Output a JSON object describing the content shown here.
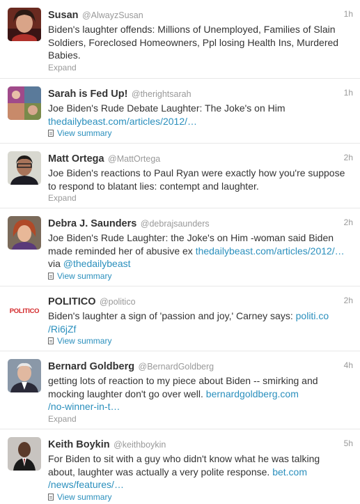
{
  "tweets": [
    {
      "name": "Susan",
      "handle": "@AlwayzSusan",
      "time": "1h",
      "lines": [
        "Biden's laughter offends: Millions of Unemployed, Families of Slain",
        "Soldiers, Foreclosed Homeowners, Ppl losing Health Ins, Murdered",
        "Babies."
      ],
      "action": "Expand"
    },
    {
      "name": "Sarah is Fed Up!",
      "handle": "@therightsarah",
      "time": "1h",
      "lines": [
        "Joe Biden's Rude Debate Laughter: The Joke's on Him"
      ],
      "link": "thedailybeast.com/articles/2012/…",
      "action": "View summary"
    },
    {
      "name": "Matt Ortega",
      "handle": "@MattOrtega",
      "time": "2h",
      "lines": [
        "Joe Biden's reactions to Paul Ryan were exactly how you're suppose",
        "to respond to blatant lies: contempt and laughter."
      ],
      "action": "Expand"
    },
    {
      "name": "Debra J. Saunders",
      "handle": "@debrajsaunders",
      "time": "2h",
      "line1": "Joe Biden's Rude Laughter: the Joke's on Him -woman said Biden",
      "line2_text": "made reminded her of abusive ex ",
      "line2_link": "thedailybeast.com/articles/2012/…",
      "line3_text": "via ",
      "line3_link": "@thedailybeast",
      "action": "View summary"
    },
    {
      "name": "POLITICO",
      "handle": "@politico",
      "time": "2h",
      "avatar_text": "POLITICO",
      "line1_text": "Biden's laughter a sign of 'passion and joy,' Carney says: ",
      "line1_link": "politi.co",
      "line2_link": "/Ri6jZf",
      "action": "View summary"
    },
    {
      "name": "Bernard Goldberg",
      "handle": "@BernardGoldberg",
      "time": "4h",
      "line1": "getting lots of reaction to my piece about Biden -- smirking and",
      "line2_text": "mocking laughter don't go over well. ",
      "line2_link": "bernardgoldberg.com",
      "line3_link": "/no-winner-in-t…",
      "action": "Expand"
    },
    {
      "name": "Keith Boykin",
      "handle": "@keithboykin",
      "time": "5h",
      "line1": "For Biden to sit with a guy who didn't know what he was talking",
      "line2_text": "about, laughter was actually a very polite response. ",
      "line2_link": "bet.com",
      "line3_link": "/news/features/…",
      "action": "View summary"
    }
  ],
  "colors": {
    "link": "#2a8fbd",
    "meta": "#999999",
    "text": "#333333"
  }
}
